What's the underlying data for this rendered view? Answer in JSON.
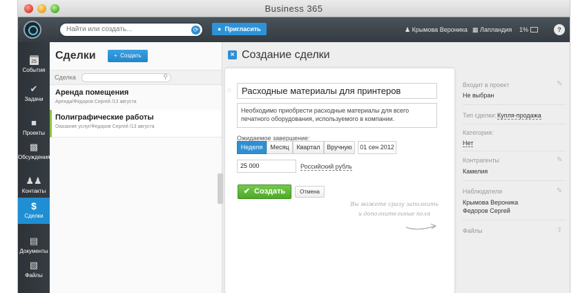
{
  "window": {
    "title": "Business 365"
  },
  "topbar": {
    "search_placeholder": "Найти или создать...",
    "invite_label": "Пригласить",
    "user_name": "Крымова Вероника",
    "org_name": "Лапландия",
    "disk_usage": "1%"
  },
  "sidebar": {
    "items": [
      {
        "label": "События",
        "icon": "calendar-icon",
        "day": "25"
      },
      {
        "label": "Задачи",
        "icon": "checkmark-icon"
      },
      {
        "label": "Проекты",
        "icon": "briefcase-icon"
      },
      {
        "label": "Обсуждения",
        "icon": "chat-icon"
      },
      {
        "label": "Контакты",
        "icon": "people-icon"
      },
      {
        "label": "Сделки",
        "icon": "dollar-icon"
      },
      {
        "label": "Документы",
        "icon": "document-icon"
      },
      {
        "label": "Файлы",
        "icon": "files-icon"
      }
    ]
  },
  "list": {
    "title": "Сделки",
    "create_label": "Создать",
    "filter_label": "Сделка",
    "items": [
      {
        "title": "Аренда помещения",
        "subtitle": "Аренда/Федоров Сергей /13 августа"
      },
      {
        "title": "Полиграфические работы",
        "subtitle": "Оказание услуг/Федоров Сергей /13 августа"
      }
    ]
  },
  "form": {
    "title": "Создание сделки",
    "name_value": "Расходные материалы для принтеров",
    "description": "Необходимо приобрести расходные материалы для всего печатного оборудования, используемого в компании.",
    "due_label": "Ожидаемое завершение:",
    "due_options": [
      "Неделя",
      "Месяц",
      "Квартал",
      "Вручную"
    ],
    "due_selected": "Неделя",
    "due_date": "01 сен 2012",
    "amount": "25 000",
    "currency": "Российский рубль",
    "submit_label": "Создать",
    "cancel_label": "Отмена",
    "hint_line1": "Вы можете сразу заполнить",
    "hint_line2": "и дополнительные поля"
  },
  "attributes": {
    "project_label": "Входит в проект",
    "project_value": "Не выбран",
    "type_label": "Тип сделки:",
    "type_value": "Купля-продажа",
    "category_label": "Категория:",
    "category_value": "Нет",
    "contractors_label": "Контрагенты",
    "contractors_value": "Камелия",
    "observers_label": "Наблюдатели",
    "observers": [
      "Крымова Вероника",
      "Федоров Сергей"
    ],
    "files_label": "Файлы"
  },
  "colors": {
    "accent": "#2f8fd1",
    "sidebar_bg": "#323940",
    "success": "#5cb431",
    "selected_marker": "#8cc63f"
  }
}
